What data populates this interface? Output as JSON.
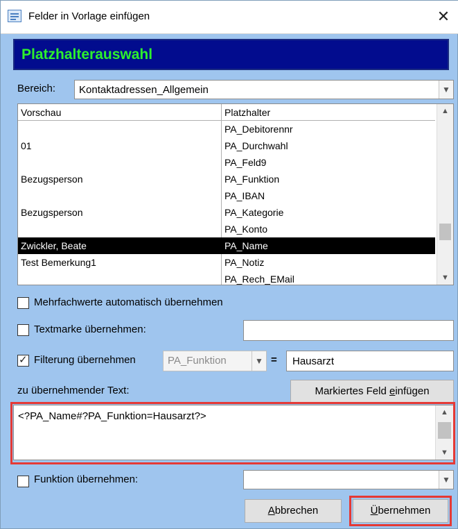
{
  "window": {
    "title": "Felder in Vorlage einfügen",
    "close_symbol": "✕"
  },
  "banner": {
    "text": "Platzhalterauswahl",
    "bg_color": "#020c8e",
    "text_color": "#2df02d"
  },
  "bereich": {
    "label": "Bereich:",
    "value": "Kontaktadressen_Allgemein"
  },
  "list": {
    "columns": [
      "Vorschau",
      "Platzhalter"
    ],
    "rows": [
      {
        "vorschau": "",
        "platzhalter": "PA_Debitorennr"
      },
      {
        "vorschau": "01",
        "platzhalter": "PA_Durchwahl"
      },
      {
        "vorschau": "",
        "platzhalter": "PA_Feld9"
      },
      {
        "vorschau": "Bezugsperson",
        "platzhalter": "PA_Funktion"
      },
      {
        "vorschau": "",
        "platzhalter": "PA_IBAN"
      },
      {
        "vorschau": "Bezugsperson",
        "platzhalter": "PA_Kategorie"
      },
      {
        "vorschau": "",
        "platzhalter": "PA_Konto"
      },
      {
        "vorschau": "Zwickler, Beate",
        "platzhalter": "PA_Name"
      },
      {
        "vorschau": "Test Bemerkung1",
        "platzhalter": "PA_Notiz"
      },
      {
        "vorschau": "",
        "platzhalter": "PA_Rech_EMail"
      }
    ],
    "selected_index": 7
  },
  "options": {
    "mehrfach": {
      "label": "Mehrfachwerte automatisch übernehmen",
      "checked": false
    },
    "textmarke": {
      "label": "Textmarke übernehmen:",
      "checked": false,
      "value": ""
    },
    "filterung": {
      "label": "Filterung übernehmen",
      "checked": true,
      "field": "PA_Funktion",
      "equals": "=",
      "value": "Hausarzt"
    },
    "funktion": {
      "label": "Funktion übernehmen:",
      "checked": false,
      "value": ""
    }
  },
  "text_section": {
    "label": "zu übernehmender Text:",
    "insert_button": {
      "pre": "Markiertes Feld ",
      "access": "e",
      "post": "infügen"
    },
    "value": "<?PA_Name#?PA_Funktion=Hausarzt?>"
  },
  "buttons": {
    "abbrechen": {
      "access": "A",
      "post": "bbrechen"
    },
    "uebernehmen": {
      "access": "Ü",
      "post": "bernehmen"
    }
  },
  "icons": {
    "dropdown": "▼",
    "scroll_up": "▲",
    "scroll_down": "▼",
    "check": "✓",
    "window": "form-icon"
  },
  "highlight_color": "#e53935"
}
